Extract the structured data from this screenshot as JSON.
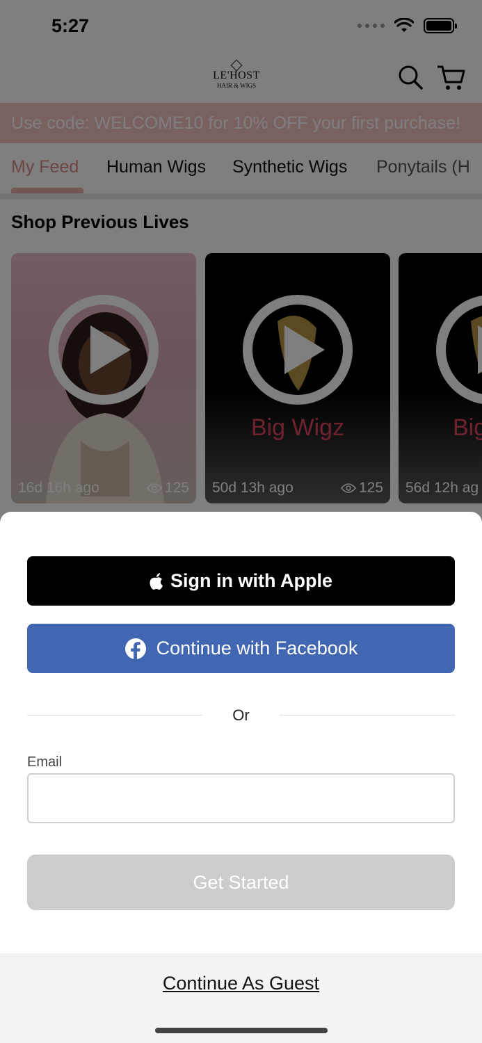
{
  "status_bar": {
    "time": "5:27"
  },
  "header": {
    "logo_line1": "LE'HOST",
    "logo_line2": "HAIR & WIGS",
    "search_icon": "search-icon",
    "cart_icon": "cart-icon"
  },
  "promo": {
    "text": "Use code: WELCOME10 for 10% OFF your first purchase!"
  },
  "tabs": [
    {
      "label": "My Feed"
    },
    {
      "label": "Human Wigs"
    },
    {
      "label": "Synthetic Wigs"
    },
    {
      "label": "Ponytails (H"
    }
  ],
  "section": {
    "title": "Shop Previous Lives"
  },
  "cards": [
    {
      "time": "16d 16h ago",
      "views": "125",
      "brand": ""
    },
    {
      "time": "50d 13h ago",
      "views": "125",
      "brand": "Big Wigz"
    },
    {
      "time": "56d 12h ag",
      "views": "",
      "brand": "Big"
    }
  ],
  "sheet": {
    "apple_label": "Sign in with Apple",
    "facebook_label": "Continue with Facebook",
    "or_text": "Or",
    "email_label": "Email",
    "email_value": "",
    "get_started_label": "Get Started",
    "guest_label": "Continue As Guest"
  },
  "colors": {
    "promo_bg": "#f3c3c1",
    "active_tab": "#d88a86",
    "facebook_blue": "#4267b2",
    "apple_black": "#000000",
    "disabled_button": "#cccccc"
  }
}
